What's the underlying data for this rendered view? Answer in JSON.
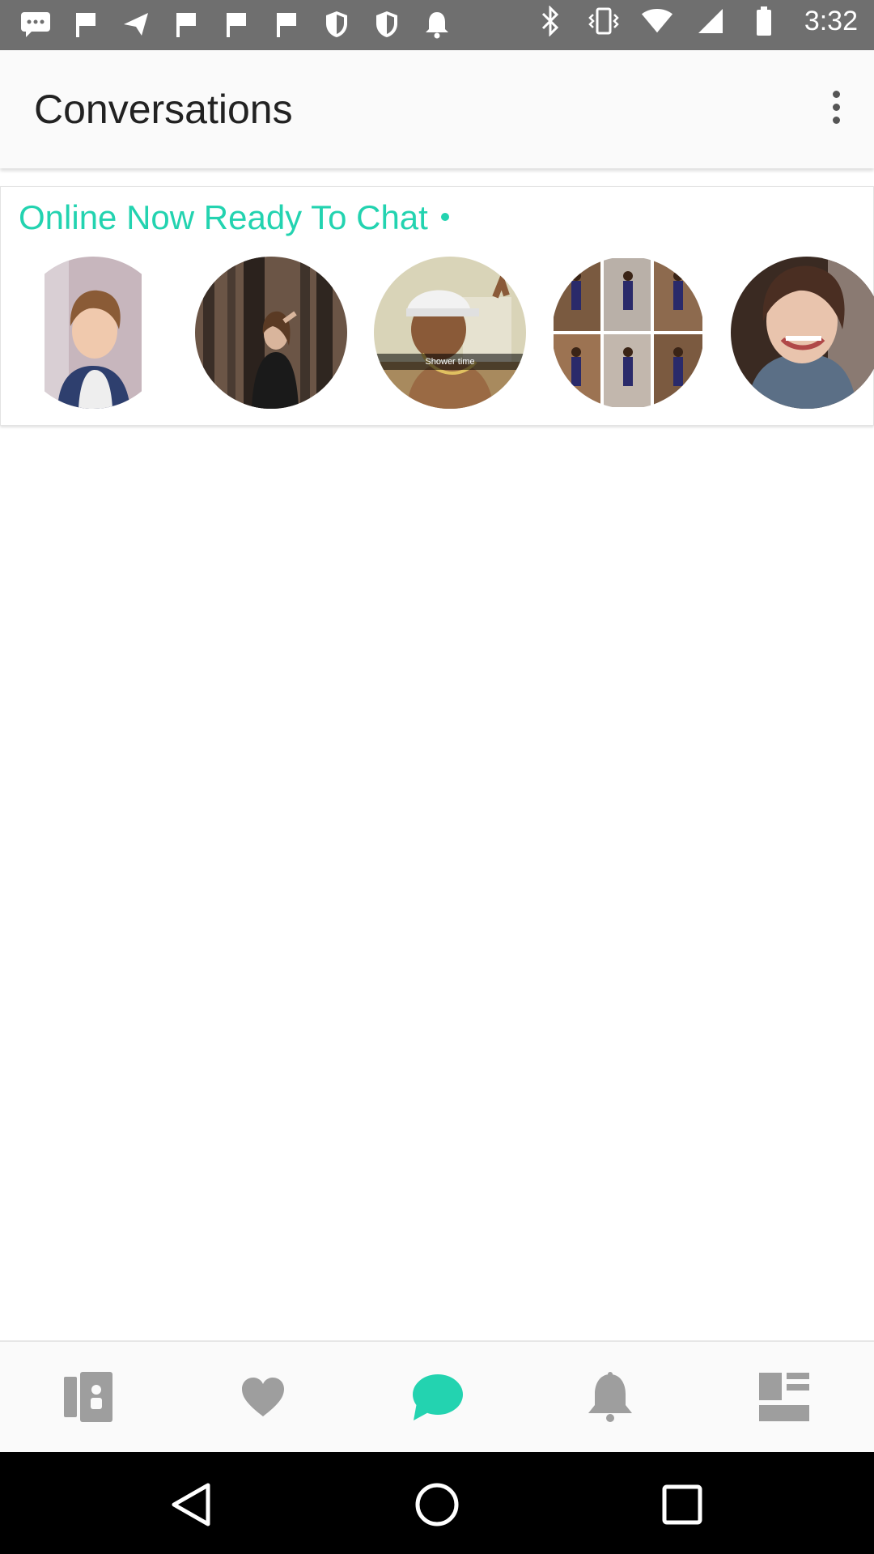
{
  "status_bar": {
    "time": "3:32",
    "left_icons": [
      "message-icon",
      "flag-icon",
      "send-icon",
      "flag-icon",
      "flag-icon",
      "flag-icon",
      "shield-icon",
      "shield-icon",
      "bell-icon"
    ],
    "right_icons": [
      "bluetooth-icon",
      "vibrate-icon",
      "wifi-icon",
      "signal-icon",
      "battery-icon"
    ]
  },
  "app_bar": {
    "title": "Conversations",
    "menu_icon": "more-vert-icon"
  },
  "online_section": {
    "heading": "Online Now Ready To Chat",
    "avatars": [
      {
        "name": "online-user-1"
      },
      {
        "name": "online-user-2"
      },
      {
        "name": "online-user-3",
        "caption": "Shower time"
      },
      {
        "name": "online-user-4"
      },
      {
        "name": "online-user-5"
      }
    ]
  },
  "bottom_nav": {
    "items": [
      {
        "icon": "profile-card-icon",
        "active": false
      },
      {
        "icon": "heart-icon",
        "active": false
      },
      {
        "icon": "chat-bubble-icon",
        "active": true
      },
      {
        "icon": "bell-icon",
        "active": false
      },
      {
        "icon": "dashboard-icon",
        "active": false
      }
    ],
    "colors": {
      "inactive": "#9e9e9e",
      "active": "#23d3b0"
    }
  },
  "system_nav": {
    "buttons": [
      "back-icon",
      "home-icon",
      "recents-icon"
    ]
  },
  "colors": {
    "accent": "#23d3b0",
    "status_bar": "#6f6f6f"
  }
}
